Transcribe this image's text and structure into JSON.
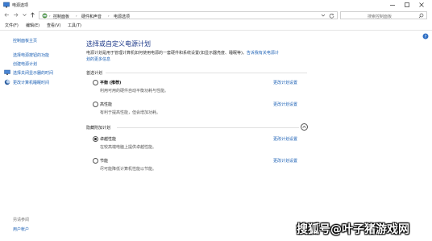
{
  "window": {
    "title": "电源选项"
  },
  "address": {
    "breadcrumbs": [
      "控制面板",
      "硬件和声音",
      "电源选项"
    ],
    "search_placeholder": "搜索控制面板"
  },
  "menu": [
    "文件(F)",
    "编辑(E)",
    "查看(V)",
    "工具(T)"
  ],
  "sidebar": {
    "items": [
      {
        "label": "控制面板主页",
        "icon": null
      },
      {
        "label": "选择电源按钮的功能",
        "icon": null
      },
      {
        "label": "创建电源计划",
        "icon": null
      },
      {
        "label": "选择关闭显示器的时间",
        "icon": "monitor-icon"
      },
      {
        "label": "更改计算机睡眠时间",
        "icon": "sleep-icon"
      }
    ],
    "footer_heading": "另请参阅",
    "footer_link": "用户帐户"
  },
  "main": {
    "title": "选择或自定义电源计划",
    "description_line1": "电源计划是用于管理计算机如何使用电源的一套硬件和系统设置(如显示器亮度、睡眠等)。",
    "description_link1": "告诉我有关电源计",
    "description_link2": "划的更多信息",
    "preferred_label": "首选计划",
    "hidden_label": "隐藏附加计划",
    "change_label": "更改计划设置",
    "plans": [
      {
        "name": "平衡 (推荐)",
        "desc": "利用可用的硬件自动平衡功耗与性能。",
        "selected": false,
        "bold": true
      },
      {
        "name": "高性能",
        "desc": "有利于提高性能，但会增加功耗。",
        "selected": false,
        "bold": false
      },
      {
        "name": "卓越性能",
        "desc": "在较高端电脑上提供卓越性能。",
        "selected": true,
        "bold": false
      },
      {
        "name": "节能",
        "desc": "尽可能降低计算机性能以节能。",
        "selected": false,
        "bold": false
      }
    ]
  },
  "watermark": "搜狐号@叶子猪游戏网"
}
